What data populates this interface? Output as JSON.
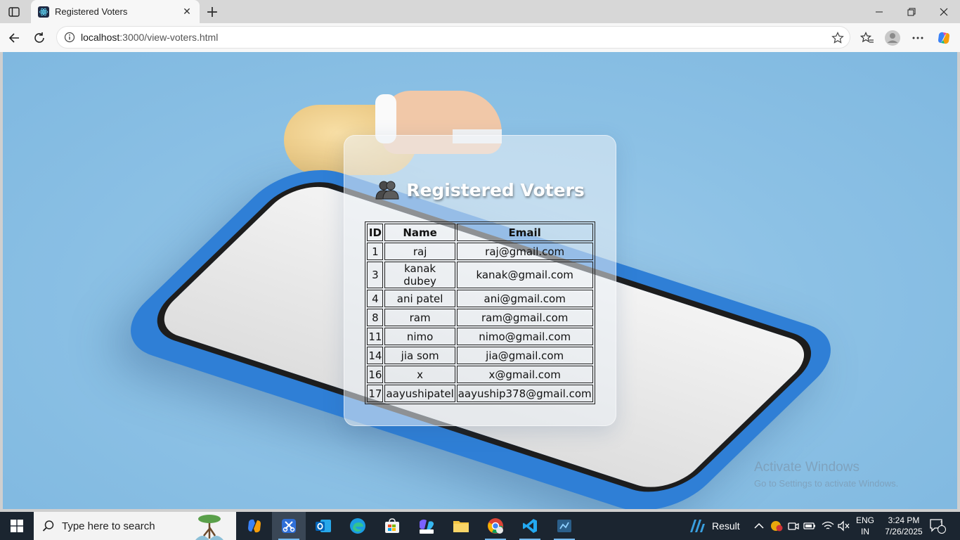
{
  "browser": {
    "tab_title": "Registered Voters",
    "new_tab_glyph": "+",
    "close_glyph": "✕",
    "url_host": "localhost",
    "url_path": ":3000/view-voters.html"
  },
  "page": {
    "heading": "Registered Voters",
    "heading_icon": "people-icon",
    "table": {
      "headers": [
        "ID",
        "Name",
        "Email"
      ],
      "rows": [
        [
          "1",
          "raj",
          "raj@gmail.com"
        ],
        [
          "3",
          "kanak dubey",
          "kanak@gmail.com"
        ],
        [
          "4",
          "ani patel",
          "ani@gmail.com"
        ],
        [
          "8",
          "ram",
          "ram@gmail.com"
        ],
        [
          "11",
          "nimo",
          "nimo@gmail.com"
        ],
        [
          "14",
          "jia som",
          "jia@gmail.com"
        ],
        [
          "16",
          "x",
          "x@gmail.com"
        ],
        [
          "17",
          "aayushipatel",
          "aayuship378@gmail.com"
        ]
      ]
    }
  },
  "watermark": {
    "title": "Activate Windows",
    "subtitle": "Go to Settings to activate Windows."
  },
  "taskbar": {
    "search_placeholder": "Type here to search",
    "weather_label": "Result",
    "lang_line1": "ENG",
    "lang_line2": "IN",
    "time": "3:24 PM",
    "date": "7/26/2025",
    "notification_count": "1"
  },
  "colors": {
    "page_bg": "#8cc1e5",
    "phone_blue": "#2f7fd6",
    "taskbar_bg": "#1b2530",
    "accent": "#76b9ed"
  }
}
